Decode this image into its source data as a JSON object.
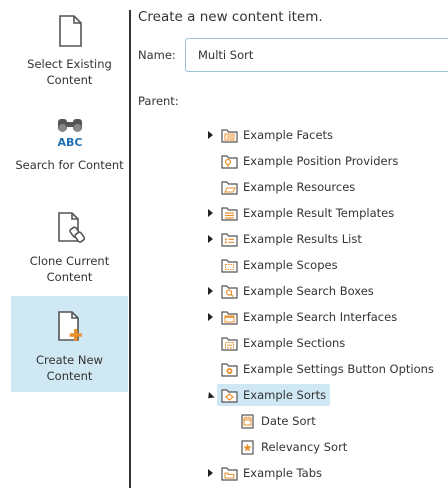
{
  "sidebar": {
    "items": [
      {
        "label": "Select Existing Content",
        "icon": "document-icon",
        "active": false
      },
      {
        "label": "Search for Content",
        "icon": "binoculars-abc-icon",
        "active": false
      },
      {
        "label": "Clone Current Content",
        "icon": "clone-document-icon",
        "active": false
      },
      {
        "label": "Create New Content",
        "icon": "new-document-icon",
        "active": true
      }
    ]
  },
  "main": {
    "title": "Create a new content item.",
    "name_label": "Name:",
    "name_value": "Multi Sort",
    "parent_label": "Parent:"
  },
  "tree": [
    {
      "label": "Example Facets",
      "icon": "facets-folder-icon",
      "toggle": "collapsed",
      "selected": false
    },
    {
      "label": "Example Position Providers",
      "icon": "position-folder-icon",
      "toggle": "none",
      "selected": false
    },
    {
      "label": "Example Resources",
      "icon": "resources-folder-icon",
      "toggle": "none",
      "selected": false
    },
    {
      "label": "Example Result Templates",
      "icon": "templates-folder-icon",
      "toggle": "collapsed",
      "selected": false
    },
    {
      "label": "Example Results List",
      "icon": "results-list-folder-icon",
      "toggle": "collapsed",
      "selected": false
    },
    {
      "label": "Example Scopes",
      "icon": "scopes-folder-icon",
      "toggle": "none",
      "selected": false
    },
    {
      "label": "Example Search Boxes",
      "icon": "search-box-folder-icon",
      "toggle": "collapsed",
      "selected": false
    },
    {
      "label": "Example Search Interfaces",
      "icon": "interface-folder-icon",
      "toggle": "collapsed",
      "selected": false
    },
    {
      "label": "Example Sections",
      "icon": "sections-folder-icon",
      "toggle": "none",
      "selected": false
    },
    {
      "label": "Example Settings Button Options",
      "icon": "settings-folder-icon",
      "toggle": "none",
      "selected": false
    },
    {
      "label": "Example Sorts",
      "icon": "sorts-folder-icon",
      "toggle": "expanded",
      "selected": true
    },
    {
      "label": "Date Sort",
      "icon": "date-sort-icon",
      "toggle": "none",
      "selected": false,
      "child": true
    },
    {
      "label": "Relevancy Sort",
      "icon": "relevancy-sort-icon",
      "toggle": "none",
      "selected": false,
      "child": true
    },
    {
      "label": "Example Tabs",
      "icon": "tabs-folder-icon",
      "toggle": "collapsed",
      "selected": false
    }
  ],
  "colors": {
    "selection": "#cfe8f3",
    "input_border": "#9cc3d9",
    "icon_stroke": "#555555",
    "icon_accent": "#e8912c",
    "abc_blue": "#1f6fb2"
  }
}
